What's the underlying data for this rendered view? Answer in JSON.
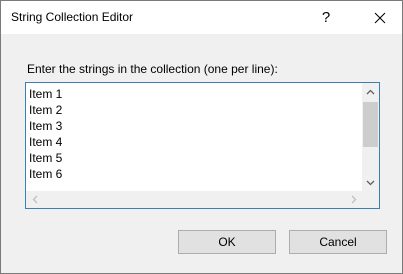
{
  "window": {
    "title": "String Collection Editor",
    "help_label": "?"
  },
  "prompt": "Enter the strings in the collection (one per line):",
  "items": [
    "Item 1",
    "Item 2",
    "Item 3",
    "Item 4",
    "Item 5",
    "Item 6"
  ],
  "buttons": {
    "ok": "OK",
    "cancel": "Cancel"
  },
  "icons": {
    "close": "close-icon",
    "scroll_up": "chevron-up-icon",
    "scroll_down": "chevron-down-icon",
    "scroll_left": "chevron-left-icon",
    "scroll_right": "chevron-right-icon"
  },
  "colors": {
    "dialog_bg": "#f0f0f0",
    "listbox_border": "#3c7fb1",
    "button_bg": "#e1e1e1"
  }
}
